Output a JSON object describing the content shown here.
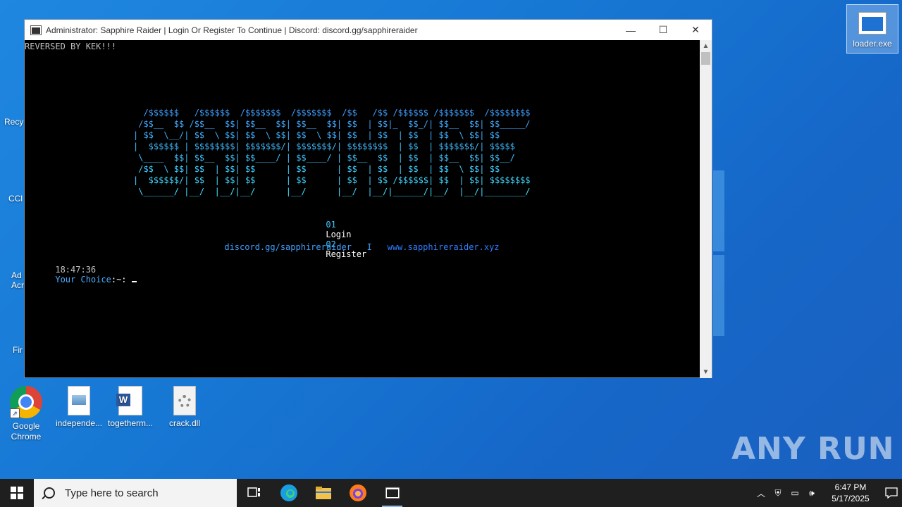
{
  "desktop": {
    "icons": [
      {
        "label": "Google Chrome"
      },
      {
        "label": "independe..."
      },
      {
        "label": "togetherm..."
      },
      {
        "label": "crack.dll"
      },
      {
        "label": "loader.exe"
      }
    ],
    "clipped_labels": [
      "Recy",
      "CCl",
      "Ad\nAcr",
      "Fir"
    ],
    "watermark": "ANY RUN"
  },
  "window": {
    "title": "Administrator:  Sapphire Raider   |   Login Or Register To Continue   |   Discord: discord.gg/sapphireraider",
    "minimize": "—",
    "maximize": "☐",
    "close": "✕"
  },
  "console": {
    "header": "REVERSED BY KEK!!!",
    "ascii_art": [
      "  /$$$$$$   /$$$$$$  /$$$$$$$  /$$$$$$$  /$$   /$$ /$$$$$$ /$$$$$$$  /$$$$$$$$",
      " /$$__  $$ /$$__  $$| $$__  $$| $$__  $$| $$  | $$|_  $$_/| $$__  $$| $$_____/",
      "| $$  \\__/| $$  \\ $$| $$  \\ $$| $$  \\ $$| $$  | $$  | $$  | $$  \\ $$| $$      ",
      "|  $$$$$$ | $$$$$$$$| $$$$$$$/| $$$$$$$/| $$$$$$$$  | $$  | $$$$$$$/| $$$$$   ",
      " \\____  $$| $$__  $$| $$____/ | $$____/ | $$__  $$  | $$  | $$__  $$| $$__/   ",
      " /$$  \\ $$| $$  | $$| $$      | $$      | $$  | $$  | $$  | $$  \\ $$| $$      ",
      "|  $$$$$$/| $$  | $$| $$      | $$      | $$  | $$ /$$$$$$| $$  | $$| $$$$$$$$",
      " \\______/ |__/  |__/|__/      |__/      |__/  |__/|______/|__/  |__/|________/"
    ],
    "menu": {
      "opt1_num": "01",
      "opt1_label": "Login",
      "opt2_num": "02",
      "opt2_label": "Register"
    },
    "links": {
      "discord": "discord.gg/sapphireraider",
      "separator": "I",
      "website": "www.sapphireraider.xyz"
    },
    "prompt": {
      "time": "18:47:36",
      "label": "Your Choice",
      "suffix": ":~: "
    }
  },
  "taskbar": {
    "search_placeholder": "Type here to search",
    "time": "6:47 PM",
    "date": "5/17/2025"
  },
  "colors": {
    "art_top": "#3fa0ff",
    "art_bottom": "#40e0ff",
    "menu_num": "#3fc8ff",
    "link_discord": "#3fa0ff",
    "link_site": "#2f7fff",
    "prompt_label": "#4aaeff"
  }
}
